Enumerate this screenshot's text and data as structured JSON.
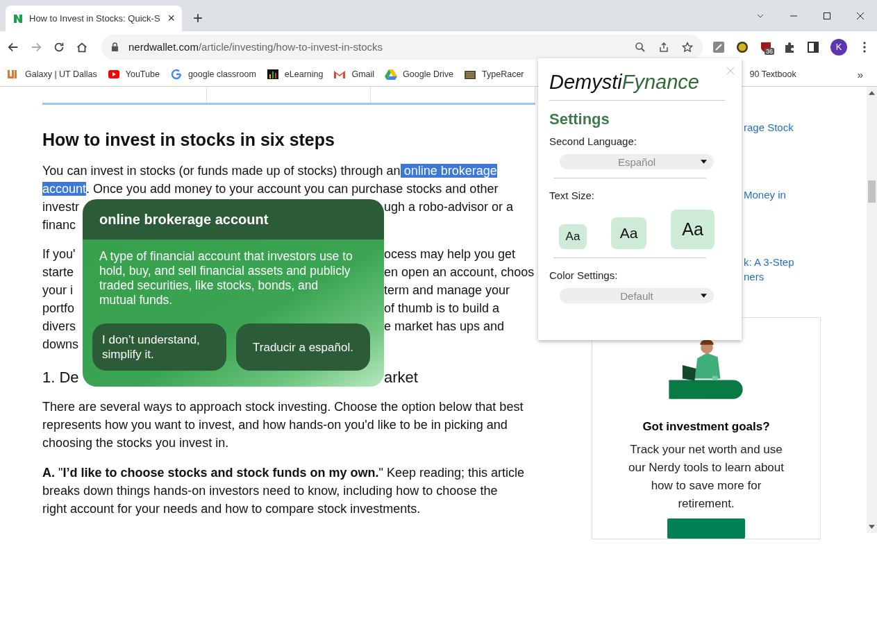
{
  "browser": {
    "tab": {
      "title": "How to Invest in Stocks: Quick-S",
      "close": "×"
    },
    "new_tab": "+",
    "address": {
      "host": "nerdwallet.com",
      "path": "/article/investing/how-to-invest-in-stocks"
    },
    "extension_badge": "36",
    "profile_initial": "K",
    "bookmarks": [
      {
        "kind": "utd",
        "label": "Galaxy | UT Dallas"
      },
      {
        "kind": "youtube",
        "label": "YouTube"
      },
      {
        "kind": "google",
        "label": "google classroom"
      },
      {
        "kind": "elearning",
        "label": "eLearning"
      },
      {
        "kind": "gmail",
        "label": "Gmail"
      },
      {
        "kind": "drive",
        "label": "Google Drive"
      },
      {
        "kind": "typeracer",
        "label": "TypeRacer"
      }
    ],
    "bookmark_fragment": "90 Textbook",
    "bookmarks_more": "»"
  },
  "article": {
    "heading": "How to invest in stocks in six steps",
    "intro_lines": [
      {
        "kind": "full",
        "parts": [
          {
            "text": "You can invest in stocks (or funds made up of stocks) through an",
            "highlighted": false
          },
          {
            "text": " online brokerage ",
            "highlighted": true
          }
        ]
      },
      {
        "kind": "full",
        "parts": [
          {
            "text": "account",
            "highlighted": true
          },
          {
            "text": ". Once you add money to your account you can purchase stocks and other",
            "highlighted": false
          }
        ]
      },
      {
        "kind": "split",
        "left": "investr",
        "right": "ugh a robo-advisor or a"
      },
      {
        "kind": "split",
        "left": "financ"
      }
    ],
    "second_lines": [
      {
        "kind": "split",
        "left": "If you'",
        "right": "ocess may help you get"
      },
      {
        "kind": "split",
        "left": "starte",
        "right": "en open an account, choos"
      },
      {
        "kind": "split",
        "left": "your i",
        "right": "term and manage your"
      },
      {
        "kind": "split",
        "left": "portfo",
        "right": "of thumb is to build a"
      },
      {
        "kind": "split",
        "left": "divers",
        "right": "e market has ups and"
      },
      {
        "kind": "split",
        "left": "downs"
      }
    ],
    "step_heading": {
      "left": "1. De",
      "right": "arket"
    },
    "paragraphs": [
      [
        "There are several ways to approach stock investing. Choose the option below that best",
        "represents how you want to invest, and how hands-on you'd like to be in picking and",
        "choosing the stocks you invest in."
      ],
      [
        "**A.** \"**I’d like to choose stocks and stock funds on my own.**\" Keep reading; this article",
        "breaks down things hands-on investors need to know, including how to choose the",
        "right account for your needs and how to compare stock investments."
      ]
    ]
  },
  "sidebar": {
    "link_fragments": [
      [
        "rage Stock"
      ],
      [
        "Money in"
      ],
      [
        "k: A 3-Step",
        "ners"
      ]
    ],
    "card": {
      "title": "Got investment goals?",
      "text": [
        "Track your net worth and use",
        "our Nerdy tools to learn about",
        "how to save more for",
        "retirement."
      ]
    }
  },
  "definition_popup": {
    "term": "online brokerage account",
    "definition": "A type of financial account that investors use to hold, buy, and sell financial assets and publicly traded securities, like stocks, bonds, and mutual funds.",
    "buttons": [
      "I don’t understand, simplify it.",
      "Traducir a español."
    ]
  },
  "settings_panel": {
    "logo": {
      "first": "Demysti",
      "second": "Fynance"
    },
    "title": "Settings",
    "second_language": {
      "label": "Second Language:",
      "value": "Español"
    },
    "text_size": {
      "label": "Text Size:",
      "options": [
        {
          "kind": "small",
          "label": "Aa"
        },
        {
          "kind": "medium",
          "label": "Aa"
        },
        {
          "kind": "large",
          "label": "Aa"
        }
      ]
    },
    "color_settings": {
      "label": "Color Settings:",
      "value": "Default"
    }
  }
}
